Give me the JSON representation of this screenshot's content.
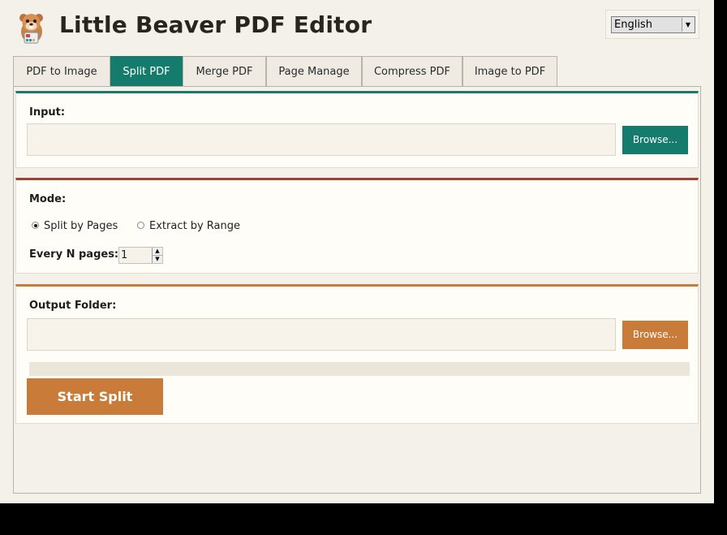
{
  "app": {
    "title": "Little Beaver PDF Editor",
    "logo_icon": "beaver-logo-icon"
  },
  "language": {
    "selected": "English",
    "arrow_icon": "chevron-down-icon"
  },
  "tabs": [
    {
      "label": "PDF to Image",
      "active": false
    },
    {
      "label": "Split PDF",
      "active": true
    },
    {
      "label": "Merge PDF",
      "active": false
    },
    {
      "label": "Page Manage",
      "active": false
    },
    {
      "label": "Compress PDF",
      "active": false
    },
    {
      "label": "Image to PDF",
      "active": false
    }
  ],
  "input_card": {
    "label": "Input:",
    "value": "",
    "browse_label": "Browse...",
    "accent": "#157b6d"
  },
  "mode_card": {
    "label": "Mode:",
    "options": [
      {
        "label": "Split by Pages",
        "checked": true
      },
      {
        "label": "Extract by Range",
        "checked": false
      }
    ],
    "every_n_label": "Every N pages:",
    "every_n_value": "1",
    "accent": "#a3412e"
  },
  "output_card": {
    "label": "Output Folder:",
    "value": "",
    "browse_label": "Browse...",
    "accent": "#c97c3a",
    "progress": 0,
    "start_label": "Start Split"
  }
}
